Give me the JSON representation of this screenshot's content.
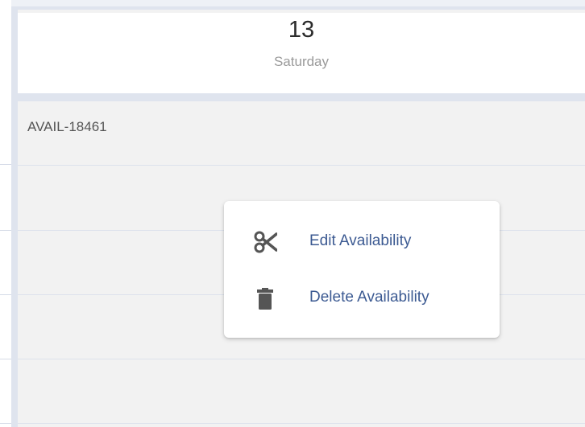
{
  "calendar": {
    "day": {
      "number": "13",
      "weekday": "Saturday"
    },
    "event": {
      "id_label": "AVAIL-18461"
    }
  },
  "context_menu": {
    "items": [
      {
        "label": "Edit Availability",
        "icon": "scissors-icon"
      },
      {
        "label": "Delete Availability",
        "icon": "trash-icon"
      }
    ]
  },
  "colors": {
    "menu_text": "#3c5a92",
    "icon": "#555555",
    "grid_background": "#f2f2f2",
    "divider": "#dfe4ee"
  }
}
